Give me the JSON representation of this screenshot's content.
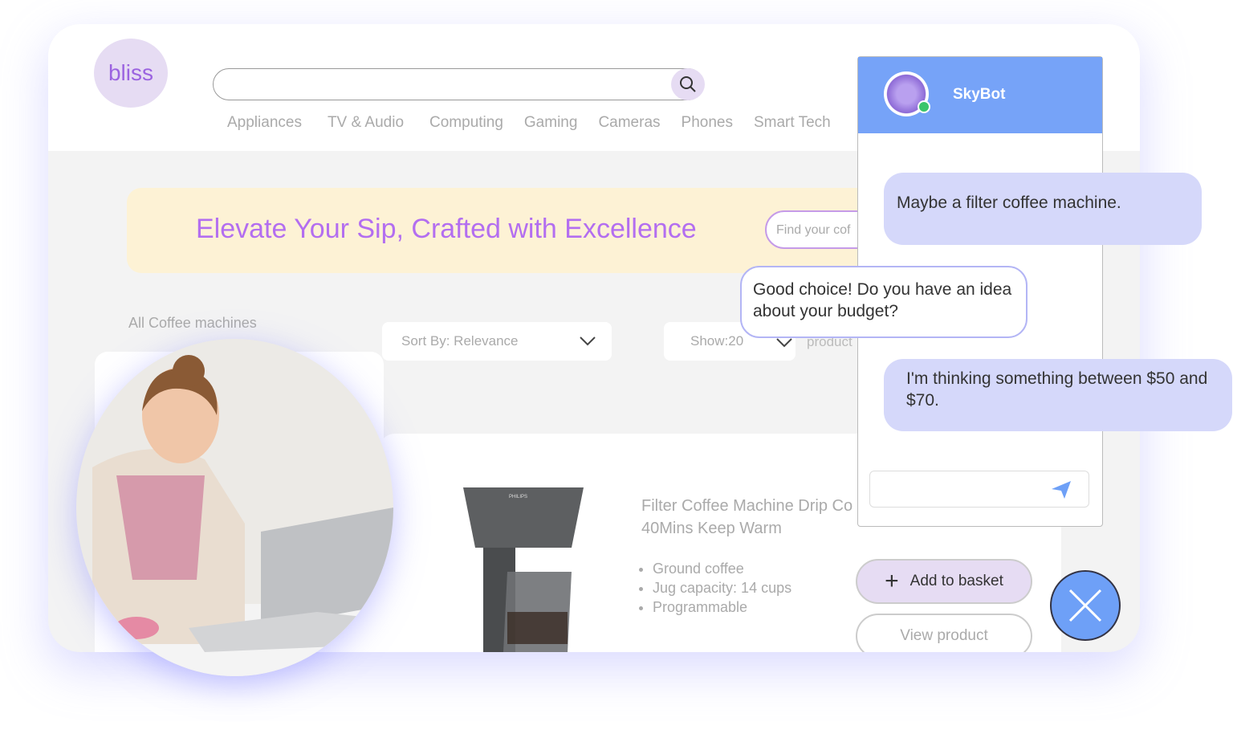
{
  "header": {
    "logo": "bliss",
    "search_placeholder": "",
    "nav": [
      "Appliances",
      "TV & Audio",
      "Computing",
      "Gaming",
      "Cameras",
      "Phones",
      "Smart Tech"
    ]
  },
  "banner": {
    "title": "Elevate Your Sip, Crafted with Excellence",
    "search_placeholder": "Find your cof"
  },
  "listing": {
    "breadcrumb": "All Coffee machines",
    "sort": "Sort By: Relevance",
    "show": "Show:20",
    "products_label": "product"
  },
  "product": {
    "title_line1": "Filter Coffee Machine Drip Co",
    "title_line2": "40Mins Keep Warm",
    "features": [
      "Ground coffee",
      "Jug capacity: 14 cups",
      "Programmable"
    ],
    "add_label": "Add to basket",
    "view_label": "View product",
    "brand": "PHILIPS"
  },
  "chat": {
    "bot_name": "SkyBot",
    "status_color": "#3bc56b",
    "accent": "#76a3f8",
    "messages": [
      {
        "from": "user",
        "text": "Maybe a filter coffee machine."
      },
      {
        "from": "bot",
        "text": "Good choice! Do you have an idea about your budget?"
      },
      {
        "from": "user",
        "text": "I'm thinking something between $50 and $70."
      }
    ],
    "input_placeholder": ""
  }
}
